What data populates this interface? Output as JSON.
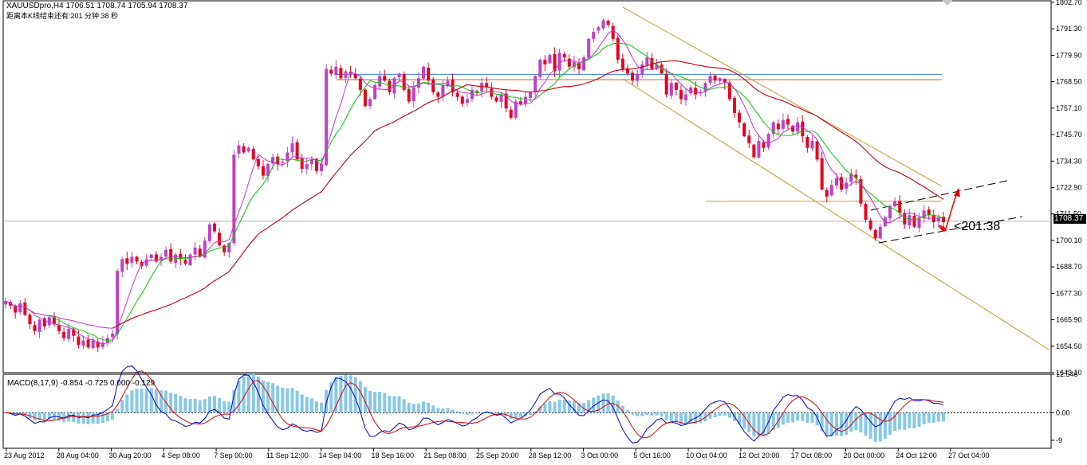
{
  "header": {
    "symbol_line": "XAUUSDpro,H4   1706.51 1708.74 1705.94 1708.37",
    "timer_line": "距离本K线结束还有:201 分钟 38 秒"
  },
  "macd_label": "MACD(8,17,9) -0.854 -0.725 0.000 -0.129",
  "current_price_label": "1708.37",
  "countdown_label": "<201:38",
  "colors": {
    "bull": "#c040c8",
    "bear": "#e8001e",
    "ma_fast": "#00cc00",
    "ma_mid": "#cc33cc",
    "ma_slow": "#cc0000",
    "channel": "#c89a30",
    "hist": "#88c8e8",
    "macd_line": "#0000cc",
    "signal_line": "#dd0000"
  },
  "chart_data": [
    {
      "type": "candlestick",
      "title": "XAUUSDpro,H4",
      "y_ticks": [
        "1802.70",
        "1791.30",
        "1779.90",
        "1768.50",
        "1757.10",
        "1745.70",
        "1734.30",
        "1722.90",
        "1711.50",
        "1700.10",
        "1688.70",
        "1677.30",
        "1665.90",
        "1654.50",
        "1643.10"
      ],
      "ylim": [
        1643.1,
        1802.7
      ],
      "x_ticks": [
        "23 Aug 2012",
        "28 Aug 04:00",
        "30 Aug 20:00",
        "4 Sep 08:00",
        "7 Sep 00:00",
        "11 Sep 12:00",
        "14 Sep 04:00",
        "18 Sep 16:00",
        "21 Sep 08:00",
        "25 Sep 20:00",
        "28 Sep 12:00",
        "3 Oct 00:00",
        "5 Oct 16:00",
        "10 Oct 04:00",
        "12 Oct 20:00",
        "17 Oct 08:00",
        "20 Oct 00:00",
        "24 Oct 12:00",
        "27 Oct 04:00"
      ],
      "close_path": [
        1674,
        1672,
        1669,
        1673,
        1668,
        1664,
        1661,
        1666,
        1663,
        1667,
        1664,
        1661,
        1658,
        1662,
        1659,
        1655,
        1657,
        1654,
        1657,
        1654,
        1656,
        1658,
        1660,
        1687,
        1692,
        1690,
        1693,
        1691,
        1689,
        1692,
        1694,
        1691,
        1693,
        1696,
        1691,
        1694,
        1692,
        1690,
        1694,
        1697,
        1693,
        1700,
        1707,
        1704,
        1698,
        1695,
        1699,
        1737,
        1741,
        1738,
        1740,
        1735,
        1732,
        1728,
        1733,
        1736,
        1733,
        1734,
        1738,
        1742,
        1735,
        1731,
        1733,
        1735,
        1730,
        1733,
        1774,
        1772,
        1775,
        1770,
        1773,
        1772,
        1770,
        1765,
        1758,
        1761,
        1767,
        1771,
        1769,
        1764,
        1770,
        1772,
        1765,
        1760,
        1766,
        1770,
        1775,
        1769,
        1764,
        1762,
        1767,
        1769,
        1764,
        1762,
        1759,
        1761,
        1765,
        1764,
        1768,
        1766,
        1762,
        1760,
        1763,
        1757,
        1753,
        1760,
        1759,
        1762,
        1764,
        1771,
        1778,
        1776,
        1780,
        1773,
        1781,
        1779,
        1775,
        1777,
        1774,
        1779,
        1787,
        1790,
        1792,
        1795,
        1793,
        1787,
        1778,
        1774,
        1772,
        1769,
        1772,
        1776,
        1779,
        1774,
        1776,
        1772,
        1763,
        1768,
        1765,
        1761,
        1763,
        1766,
        1763,
        1764,
        1768,
        1771,
        1769,
        1770,
        1768,
        1761,
        1755,
        1751,
        1745,
        1742,
        1736,
        1743,
        1740,
        1746,
        1751,
        1748,
        1752,
        1750,
        1747,
        1751,
        1745,
        1740,
        1743,
        1735,
        1722,
        1719,
        1724,
        1727,
        1722,
        1725,
        1729,
        1727,
        1716,
        1709,
        1705,
        1701,
        1706,
        1710,
        1715,
        1717,
        1712,
        1707,
        1711,
        1706,
        1710,
        1713,
        1711,
        1708,
        1710,
        1708
      ],
      "bull_color": "#c040c8",
      "bear_color": "#e8001e",
      "indicators": [
        {
          "name": "",
          "type": "moving_average",
          "color": "#00cc00"
        },
        {
          "name": "",
          "type": "moving_average",
          "color": "#cc33cc"
        },
        {
          "name": "",
          "type": "moving_average",
          "color": "#cc0000"
        }
      ],
      "horizontal_lines": [
        {
          "price": 1771.7,
          "color": "#3a7fd0"
        },
        {
          "price": 1769.4,
          "color": "#e06020"
        },
        {
          "price": 1717.0,
          "color": "#c89a30"
        }
      ],
      "current_price": 1708.37
    },
    {
      "type": "macd",
      "title": "MACD(8,17,9)",
      "values": {
        "macd": -0.854,
        "signal": -0.725,
        "zero": 0.0,
        "hist": -0.129
      },
      "y_ticks": [
        "12.546",
        "0.00",
        "-9"
      ],
      "ylim": [
        -11.6,
        12.546
      ]
    }
  ]
}
